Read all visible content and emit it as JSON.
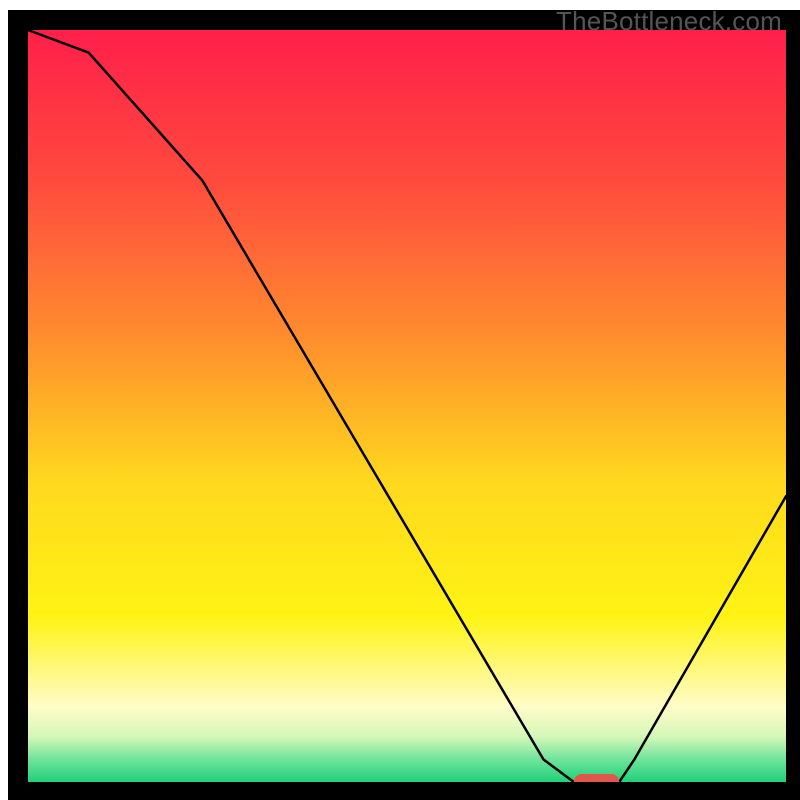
{
  "watermark": "TheBottleneck.com",
  "chart_data": {
    "type": "line",
    "title": "",
    "xlabel": "",
    "ylabel": "",
    "xlim": [
      0,
      100
    ],
    "ylim": [
      0,
      100
    ],
    "series": [
      {
        "name": "curve",
        "x": [
          0,
          8,
          23,
          68,
          72,
          78,
          80,
          100
        ],
        "y": [
          100,
          97,
          80,
          3,
          0,
          0,
          3,
          38
        ]
      }
    ],
    "marker": {
      "x_start": 72,
      "x_end": 78,
      "y": 0,
      "color": "#e2574c"
    },
    "background_gradient": [
      {
        "offset": 0.0,
        "color": "#ff1f4a"
      },
      {
        "offset": 0.2,
        "color": "#ff4a3e"
      },
      {
        "offset": 0.4,
        "color": "#ff8a2e"
      },
      {
        "offset": 0.6,
        "color": "#ffd81e"
      },
      {
        "offset": 0.78,
        "color": "#fff314"
      },
      {
        "offset": 0.9,
        "color": "#fffcc8"
      },
      {
        "offset": 0.94,
        "color": "#d4f7b8"
      },
      {
        "offset": 0.97,
        "color": "#6fe49a"
      },
      {
        "offset": 1.0,
        "color": "#1fd07a"
      }
    ],
    "frame_color": "#000000",
    "curve_color": "#000000",
    "curve_width": 2.5
  }
}
